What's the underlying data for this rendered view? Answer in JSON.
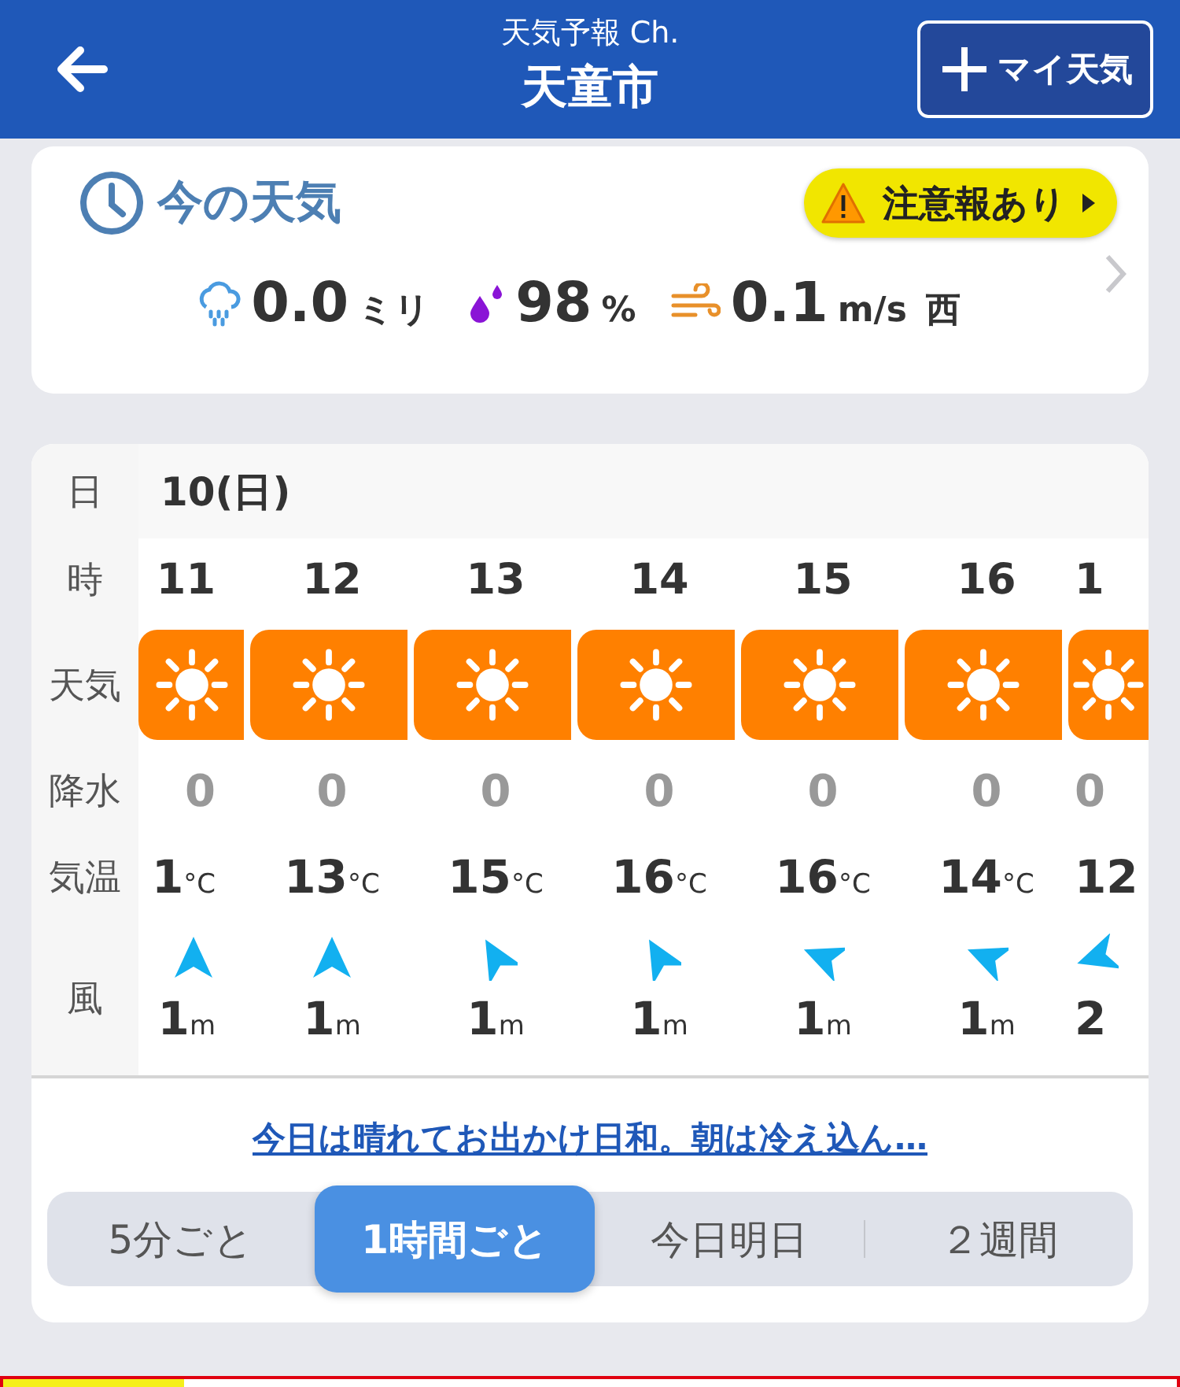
{
  "header": {
    "subtitle": "天気予報 Ch.",
    "title": "天童市",
    "my_weather_button": "マイ天気"
  },
  "current": {
    "title": "今の天気",
    "alert": "注意報あり",
    "rain": {
      "value": "0.0",
      "unit": "ミリ"
    },
    "humidity": {
      "value": "98",
      "unit": "%"
    },
    "wind": {
      "value": "0.1",
      "unit": "m/s",
      "direction": "西"
    }
  },
  "hourly": {
    "labels": {
      "date": "日",
      "hour": "時",
      "weather": "天気",
      "precip": "降水",
      "temp": "気温",
      "wind": "風"
    },
    "date": "10(日)",
    "hours": [
      {
        "hour": "11",
        "kind": "sunny",
        "precip": "0",
        "temp": "1",
        "temp_unit": "°C",
        "arrow": {
          "kind": "south"
        },
        "wind": "1",
        "wind_unit": "m"
      },
      {
        "hour": "12",
        "kind": "sunny",
        "precip": "0",
        "temp": "13",
        "temp_unit": "°C",
        "arrow": {
          "kind": "south"
        },
        "wind": "1",
        "wind_unit": "m"
      },
      {
        "hour": "13",
        "kind": "sunny",
        "precip": "0",
        "temp": "15",
        "temp_unit": "°C",
        "arrow": {
          "kind": "sse"
        },
        "wind": "1",
        "wind_unit": "m"
      },
      {
        "hour": "14",
        "kind": "sunny",
        "precip": "0",
        "temp": "16",
        "temp_unit": "°C",
        "arrow": {
          "kind": "sse"
        },
        "wind": "1",
        "wind_unit": "m"
      },
      {
        "hour": "15",
        "kind": "sunny",
        "precip": "0",
        "temp": "16",
        "temp_unit": "°C",
        "arrow": {
          "kind": "ese"
        },
        "wind": "1",
        "wind_unit": "m"
      },
      {
        "hour": "16",
        "kind": "sunny",
        "precip": "0",
        "temp": "14",
        "temp_unit": "°C",
        "arrow": {
          "kind": "ese"
        },
        "wind": "1",
        "wind_unit": "m"
      },
      {
        "hour": "1",
        "kind": "sunny",
        "precip": "0",
        "temp": "12",
        "arrow": {
          "kind": "ene"
        },
        "wind": "2"
      }
    ]
  },
  "summary_link": "今日は晴れてお出かけ日和。朝は冷え込ん…",
  "tabs": [
    {
      "label": "5分ごと",
      "selected": false
    },
    {
      "label": "1時間ごと",
      "selected": true
    },
    {
      "label": "今日明日",
      "selected": false
    },
    {
      "label": "２週間",
      "selected": false
    }
  ]
}
